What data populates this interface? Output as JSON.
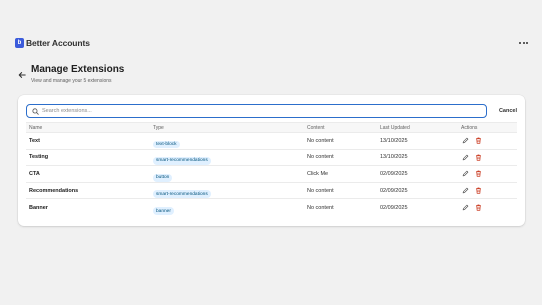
{
  "app": {
    "title": "Better Accounts",
    "logo_letter": "b"
  },
  "page": {
    "title": "Manage Extensions",
    "subtitle": "View and manage your 5 extensions"
  },
  "search": {
    "placeholder": "Search extensions...",
    "value": "",
    "cancel_label": "Cancel"
  },
  "table": {
    "headers": {
      "name": "Name",
      "type": "Type",
      "content": "Content",
      "updated": "Last Updated",
      "actions": "Actions"
    },
    "rows": [
      {
        "name": "Text",
        "type": "text-block",
        "content": "No content",
        "updated": "13/10/2025"
      },
      {
        "name": "Testing",
        "type": "smart-recommendations",
        "content": "No content",
        "updated": "13/10/2025"
      },
      {
        "name": "CTA",
        "type": "button",
        "content": "Click Me",
        "updated": "02/09/2025"
      },
      {
        "name": "Recommendations",
        "type": "smart-recommendations",
        "content": "No content",
        "updated": "02/09/2025"
      },
      {
        "name": "Banner",
        "type": "banner",
        "content": "No content",
        "updated": "02/09/2025"
      }
    ]
  },
  "colors": {
    "accent": "#2c6ecb",
    "logo": "#3b5bdb",
    "badge_bg": "#e0f0ff",
    "badge_text": "#00527c",
    "delete": "#c5280c"
  },
  "icons": {
    "back": "arrow-left-icon",
    "more": "ellipsis-icon",
    "search": "search-icon",
    "edit": "pencil-icon",
    "delete": "trash-icon"
  }
}
